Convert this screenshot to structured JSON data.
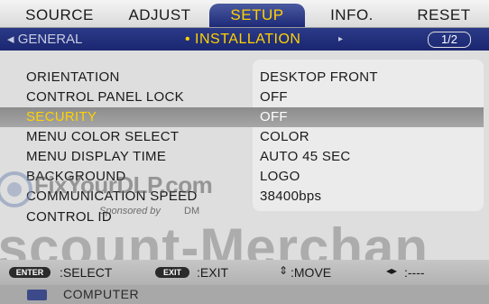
{
  "tabs": [
    {
      "label": "SOURCE"
    },
    {
      "label": "ADJUST"
    },
    {
      "label": "SETUP"
    },
    {
      "label": "INFO."
    },
    {
      "label": "RESET"
    }
  ],
  "active_tab": "SETUP",
  "subtabs": {
    "left": "◂ GENERAL",
    "current": "• INSTALLATION",
    "right_arrow": "▸",
    "page": "1/2"
  },
  "menu": {
    "items": [
      {
        "label": "ORIENTATION",
        "value": "DESKTOP FRONT"
      },
      {
        "label": "CONTROL PANEL LOCK",
        "value": "OFF"
      },
      {
        "label": "SECURITY",
        "value": "OFF",
        "selected": true
      },
      {
        "label": "MENU COLOR SELECT",
        "value": "COLOR"
      },
      {
        "label": "MENU DISPLAY TIME",
        "value": "AUTO 45 SEC"
      },
      {
        "label": "BACKGROUND",
        "value": "LOGO"
      },
      {
        "label": "COMMUNICATION SPEED",
        "value": "38400bps"
      },
      {
        "label": "CONTROL ID",
        "value": ""
      }
    ]
  },
  "help": {
    "enter_key": "ENTER",
    "enter_text": ":SELECT",
    "exit_key": "EXIT",
    "exit_text": ":EXIT",
    "move_text": ":MOVE",
    "adjust_text": ":----"
  },
  "source": {
    "label": "COMPUTER",
    "icon": "computer-icon"
  },
  "watermarks": {
    "site": "FixYourDLP.com",
    "sponsor": "Sponsored by",
    "sponsor_logo": "DM",
    "merchant": "iscount-Merchan"
  },
  "colors": {
    "active_tab_bg": "#1e2a78",
    "highlight_text": "#ffd200",
    "selected_row": "#999999"
  }
}
